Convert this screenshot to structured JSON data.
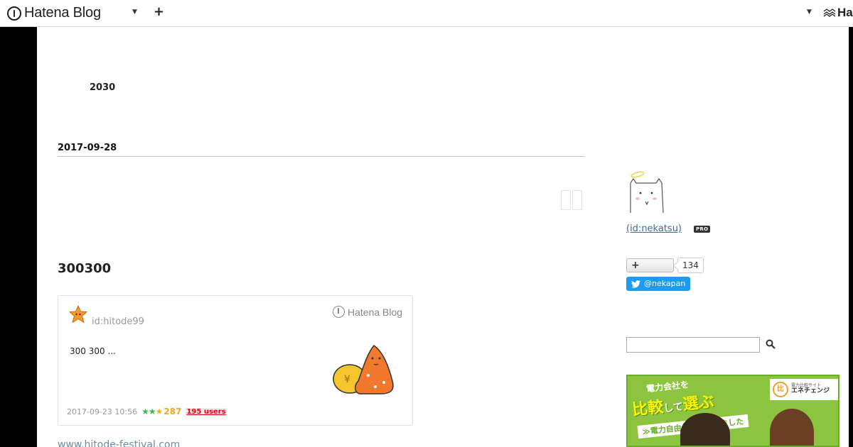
{
  "header": {
    "brand": "Hatena Blog",
    "add_icon": "plus-icon",
    "right_brand": "Ha"
  },
  "blog": {
    "title": "2030"
  },
  "entry": {
    "date": "2017-09-28",
    "heading": "300300",
    "embed": {
      "author": "id:hitode99",
      "brand": "Hatena Blog",
      "excerpt": "300 300 ...",
      "timestamp": "2017-09-23 10:56",
      "star_count": "287",
      "bookmark_users": "195 users"
    },
    "source_link": "www.hitode-festival.com"
  },
  "sidebar": {
    "profile_id": " (id:nekatsu)",
    "pro_badge": "PRO",
    "follow_count": "134",
    "twitter_handle": "@nekapan",
    "search_placeholder": ""
  },
  "ad": {
    "line1": "電力会社を",
    "big1": "比較",
    "big2": "して",
    "big3": "選ぶ",
    "sub": "≫電力自由化が始まりました",
    "logo_small": "電力比較サイト",
    "logo_name": "エネチェンジ"
  },
  "colors": {
    "accent_link": "#3c6c9a",
    "twitter": "#1d9bf0",
    "star_green": "#3db94c",
    "star_yellow": "#f2b21a",
    "bookmark_red": "#e0001a",
    "ad_green": "#8dc43f"
  }
}
